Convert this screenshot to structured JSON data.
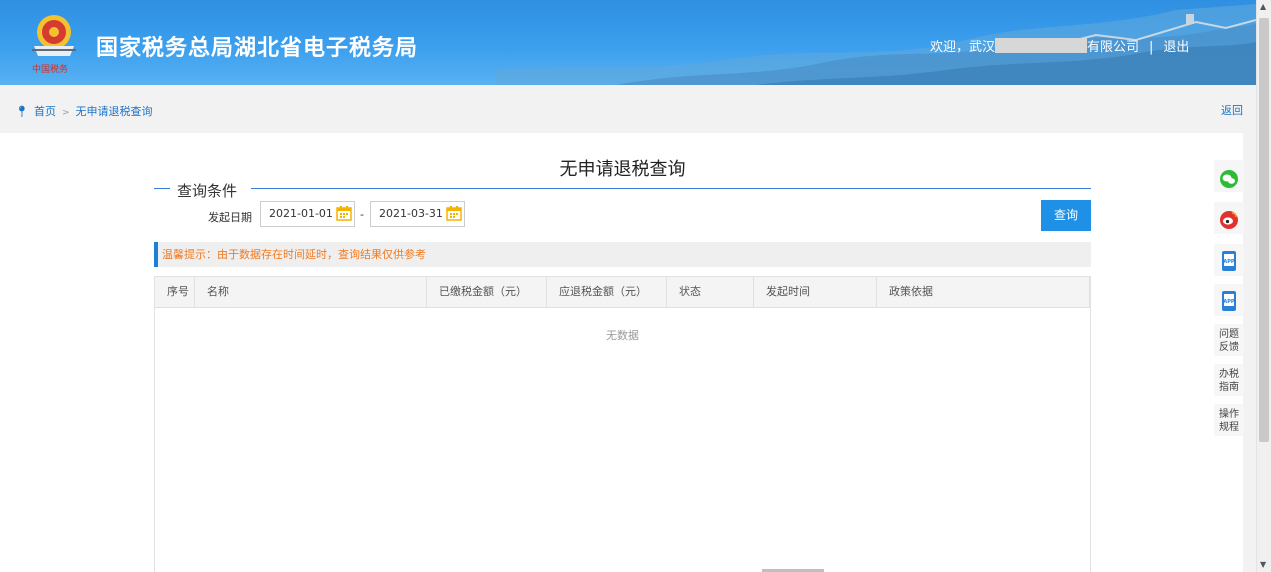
{
  "header": {
    "site_title": "国家税务总局湖北省电子税务局",
    "welcome_prefix": "欢迎，武汉",
    "company_suffix": "有限公司",
    "separator": "|",
    "logout": "退出",
    "emblem_caption": "中国税务"
  },
  "breadcrumb": {
    "home": "首页",
    "arrow": ">",
    "current": "无申请退税查询",
    "back": "返回"
  },
  "page": {
    "title": "无申请退税查询",
    "section_legend": "查询条件",
    "date_label": "发起日期",
    "date_start": "2021-01-01",
    "date_end": "2021-03-31",
    "date_separator": "-",
    "query_button": "查询",
    "tip": "温馨提示：由于数据存在时间延时，查询结果仅供参考"
  },
  "table": {
    "columns": [
      "序号",
      "名称",
      "已缴税金额（元）",
      "应退税金额（元）",
      "状态",
      "发起时间",
      "政策依据"
    ],
    "empty_text": "无数据"
  },
  "side_tools": {
    "app1": "APP",
    "app2": "APP",
    "feedback_1": "问题",
    "feedback_2": "反馈",
    "guide_1": "办税",
    "guide_2": "指南",
    "ops_1": "操作",
    "ops_2": "规程"
  },
  "colors": {
    "header_blue": "#3b9fee",
    "link_blue": "#1a73c9",
    "button_blue": "#1e90e5",
    "tip_orange": "#f07b22",
    "wechat_green": "#2dbb35",
    "weibo_red": "#e0322e"
  }
}
